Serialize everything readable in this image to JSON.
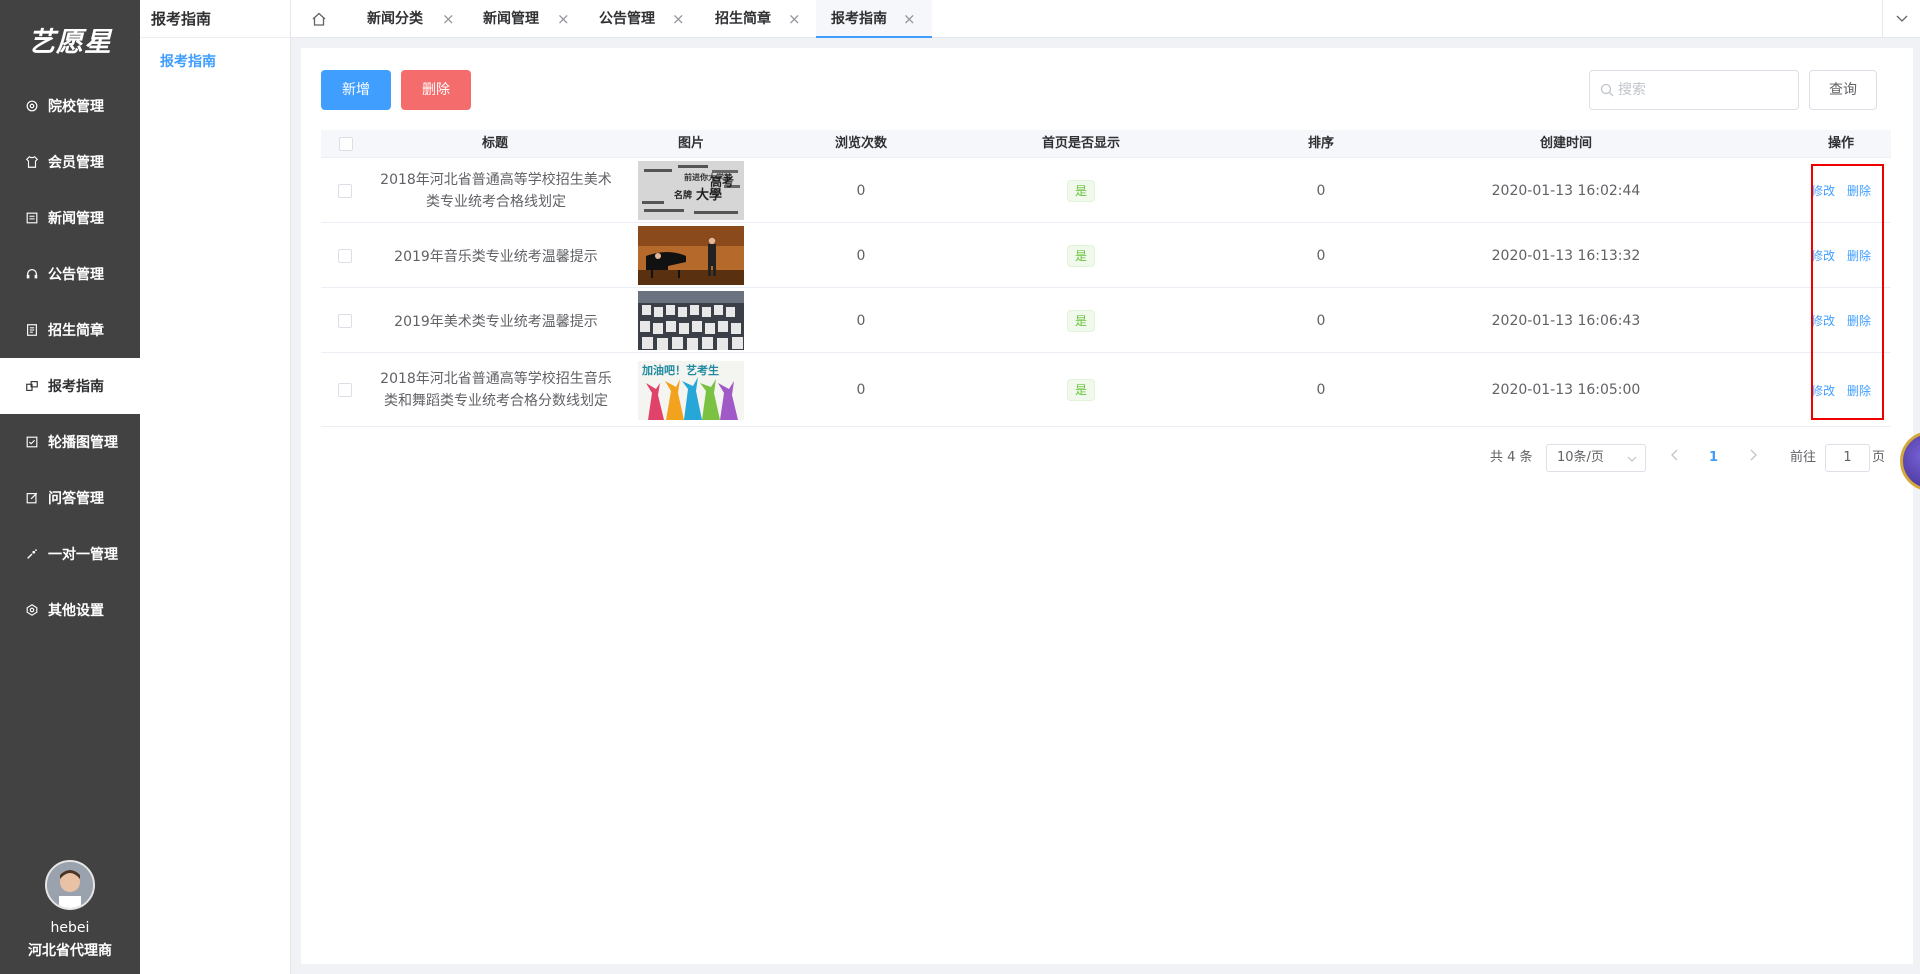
{
  "app": {
    "logo": "艺愿星"
  },
  "sidebar": {
    "items": [
      {
        "label": "院校管理",
        "icon": "gear-icon"
      },
      {
        "label": "会员管理",
        "icon": "shirt-icon"
      },
      {
        "label": "新闻管理",
        "icon": "news-icon"
      },
      {
        "label": "公告管理",
        "icon": "headset-icon"
      },
      {
        "label": "招生简章",
        "icon": "document-icon"
      },
      {
        "label": "报考指南",
        "icon": "guide-icon"
      },
      {
        "label": "轮播图管理",
        "icon": "checkbox-icon"
      },
      {
        "label": "问答管理",
        "icon": "edit-icon"
      },
      {
        "label": "一对一管理",
        "icon": "chat-icon"
      },
      {
        "label": "其他设置",
        "icon": "settings-icon"
      }
    ],
    "active_index": 5,
    "user": {
      "name": "hebei",
      "role": "河北省代理商"
    }
  },
  "subnav": {
    "title": "报考指南",
    "items": [
      "报考指南"
    ]
  },
  "tabs": [
    {
      "label": "新闻分类"
    },
    {
      "label": "新闻管理"
    },
    {
      "label": "公告管理"
    },
    {
      "label": "招生简章"
    },
    {
      "label": "报考指南"
    }
  ],
  "toolbar": {
    "add_label": "新增",
    "delete_label": "删除",
    "search_placeholder": "搜索",
    "query_label": "查询"
  },
  "table": {
    "headers": [
      "标题",
      "图片",
      "浏览次数",
      "首页是否显示",
      "排序",
      "创建时间",
      "操作"
    ],
    "edit_label": "修改",
    "delete_label": "删除",
    "rows": [
      {
        "title": "2018年河北省普通高等学校招生美术类专业统考合格线划定",
        "views": "0",
        "show": "是",
        "sort": "0",
        "created": "2020-01-13 16:02:44"
      },
      {
        "title": "2019年音乐类专业统考温馨提示",
        "views": "0",
        "show": "是",
        "sort": "0",
        "created": "2020-01-13 16:13:32"
      },
      {
        "title": "2019年美术类专业统考温馨提示",
        "views": "0",
        "show": "是",
        "sort": "0",
        "created": "2020-01-13 16:06:43"
      },
      {
        "title": "2018年河北省普通高等学校招生音乐类和舞蹈类专业统考合格分数线划定",
        "views": "0",
        "show": "是",
        "sort": "0",
        "created": "2020-01-13 16:05:00"
      }
    ]
  },
  "pagination": {
    "total_text": "共 4 条",
    "page_size": "10条/页",
    "current_page": "1",
    "goto_label": "前往",
    "goto_value": "1",
    "page_suffix": "页"
  },
  "thumb_texts": {
    "row1": [
      "前进你大学梦",
      "名牌",
      "大學",
      "高考"
    ],
    "row4": [
      "加油吧！艺考生"
    ]
  }
}
